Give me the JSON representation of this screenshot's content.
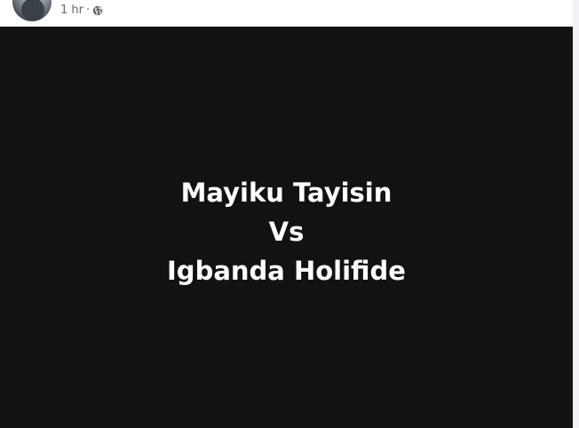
{
  "header": {
    "timestamp": "1 hr",
    "separator": "·",
    "privacy_icon": "globe-icon",
    "avatar_icon": "profile-avatar"
  },
  "post": {
    "lines": [
      "Mayiku Tayisin",
      "Vs",
      "Igbanda Holifide"
    ]
  },
  "colors": {
    "header_bg": "#ffffff",
    "post_bg": "#121212",
    "post_text": "#ffffff",
    "meta_text": "#65676b",
    "right_edge": "#f0f2f5"
  }
}
